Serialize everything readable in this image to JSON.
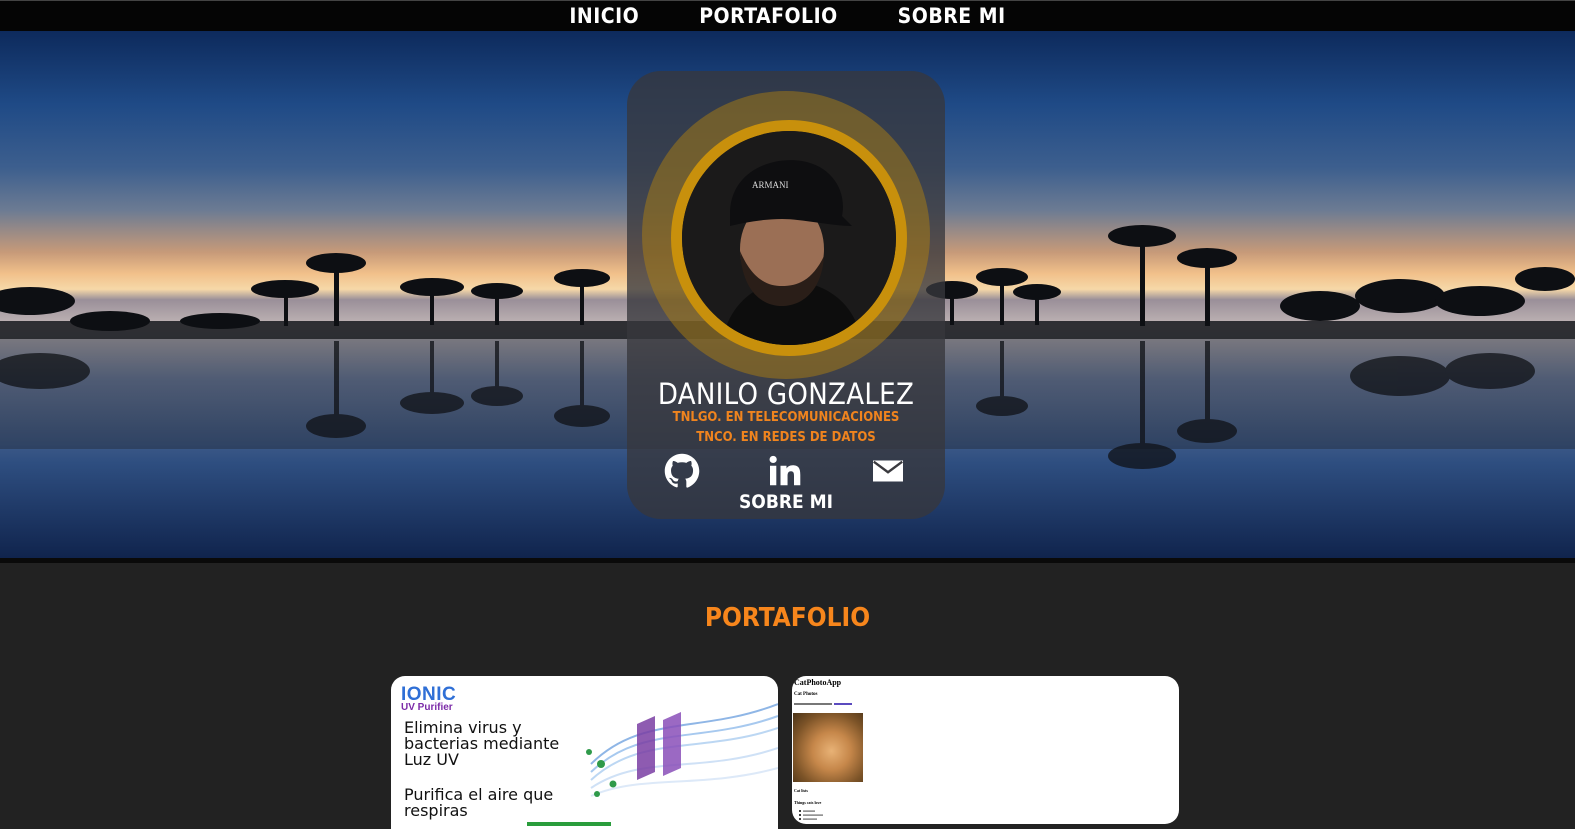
{
  "nav": {
    "items": [
      {
        "label": "INICIO"
      },
      {
        "label": "PORTAFOLIO"
      },
      {
        "label": "SOBRE MI"
      }
    ]
  },
  "profile": {
    "name": "DANILO GONZALEZ",
    "title_1": "TNLGO. EN TELECOMUNICACIONES",
    "title_2": "TNCO. EN REDES DE DATOS",
    "about_link": "SOBRE MI",
    "social_icons": [
      "github-icon",
      "linkedin-icon",
      "email-icon"
    ],
    "accent_color": "#f0841e",
    "ring_color": "#c8900c"
  },
  "portfolio": {
    "title": "PORTAFOLIO",
    "projects": [
      {
        "brand": "IONIC",
        "tagline": "UV Purifier",
        "headline": "Elimina virus y bacterias mediante Luz UV",
        "subheadline": "Purifica el aire que respiras"
      },
      {
        "title": "CatPhotoApp",
        "subtitle": "Cat Photos",
        "lists_title": "Cat lists",
        "love_title": "Things cats love"
      }
    ]
  }
}
